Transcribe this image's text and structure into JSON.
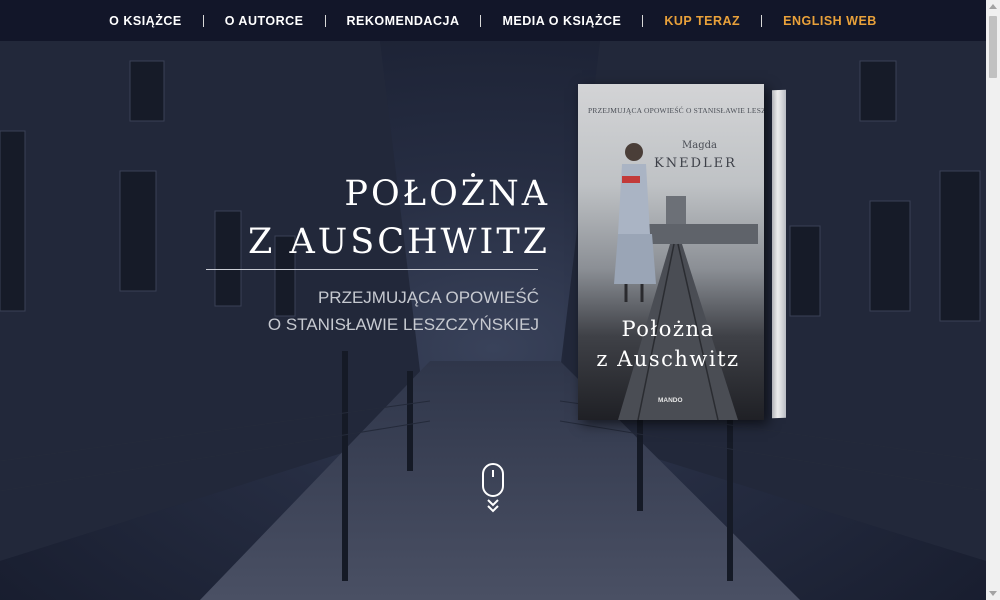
{
  "nav": {
    "items": [
      {
        "label": "O KSIĄŻCE"
      },
      {
        "label": "O AUTORCE"
      },
      {
        "label": "REKOMENDACJA"
      },
      {
        "label": "MEDIA O KSIĄŻCE"
      },
      {
        "label": "KUP TERAZ"
      },
      {
        "label": "ENGLISH WEB"
      }
    ]
  },
  "hero": {
    "title_line1": "POŁOŻNA",
    "title_line2": "Z AUSCHWITZ",
    "subtitle_line1": "PRZEJMUJĄCA OPOWIEŚĆ",
    "subtitle_line2": "O STANISŁAWIE LESZCZYŃSKIEJ"
  },
  "book": {
    "tagline": "PRZEJMUJĄCA OPOWIEŚĆ O STANISŁAWIE LESZCZYŃSKIEJ",
    "author_first": "Magda",
    "author_last": "KNEDLER",
    "title_line1": "Położna",
    "title_line2": "z Auschwitz",
    "publisher": "MANDO"
  },
  "icons": {
    "scroll": "mouse-scroll-icon",
    "scroll_arrows": "double-chevron-down-icon"
  },
  "colors": {
    "nav_bg": "#121629",
    "accent": "#e9a13a",
    "text": "#ffffff"
  }
}
